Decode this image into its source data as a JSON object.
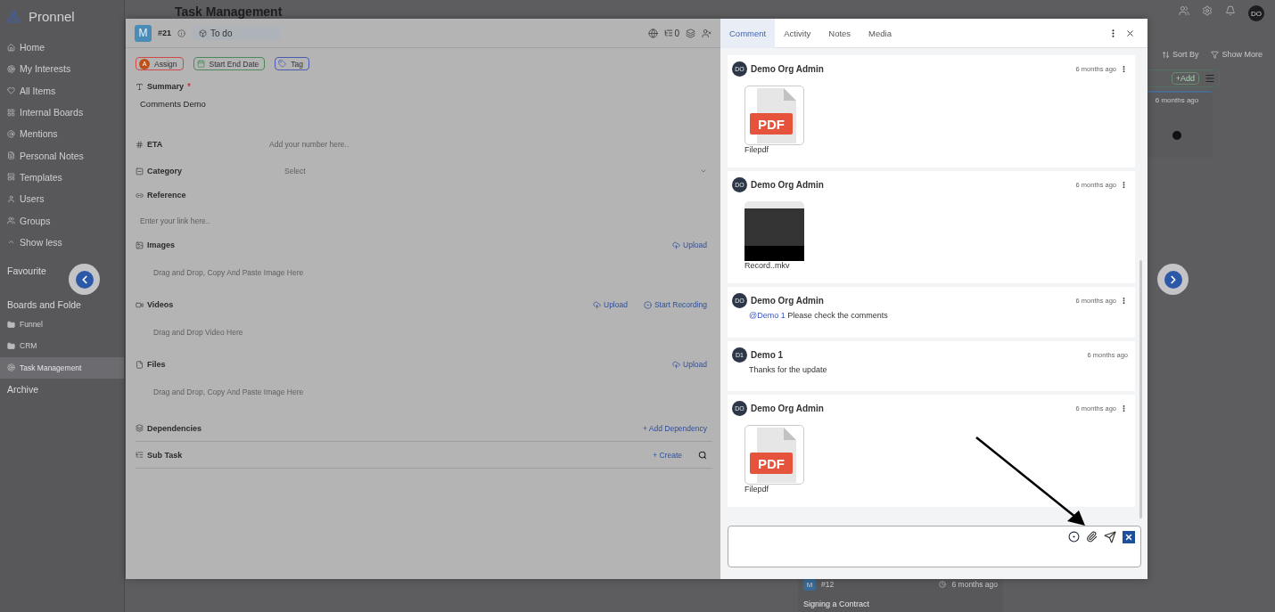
{
  "app": {
    "brand": "Pronnel",
    "page_title": "Task Management",
    "user_initials": "DO"
  },
  "sidebar": {
    "items": [
      {
        "label": "Home",
        "selected": false
      },
      {
        "label": "My Interests",
        "selected": false
      },
      {
        "label": "All Items",
        "selected": false
      },
      {
        "label": "Internal Boards",
        "selected": false
      },
      {
        "label": "Mentions",
        "selected": false
      },
      {
        "label": "Personal Notes",
        "selected": false
      },
      {
        "label": "Templates",
        "selected": false
      },
      {
        "label": "Users",
        "selected": false
      },
      {
        "label": "Groups",
        "selected": false
      }
    ],
    "toggle": "Show less",
    "sections": [
      "Favourite",
      "Boards and Folde"
    ],
    "folders": [
      {
        "label": "Funnel",
        "kind": "folder",
        "selected": false
      },
      {
        "label": "CRM",
        "kind": "folder",
        "selected": false
      },
      {
        "label": "Task Management",
        "kind": "board",
        "selected": true
      }
    ],
    "archive": "Archive"
  },
  "board": {
    "toolbar": [
      "Sort By",
      "Show More"
    ],
    "add_button": "+Add",
    "card_time": "6 months ago",
    "bottom_card": {
      "badge": "M",
      "number": "#12",
      "time": "6 months ago",
      "title": "Signing a Contract"
    }
  },
  "task": {
    "avatar": "M",
    "number": "#21",
    "status": "To do",
    "watchers": "0",
    "chips": [
      {
        "label": "Assign",
        "kind": "assign",
        "avatar": "A"
      },
      {
        "label": "Start End Date",
        "kind": "date"
      },
      {
        "label": "Tag",
        "kind": "tag"
      }
    ],
    "fields": [
      {
        "kind": "textarea",
        "label": "Summary",
        "required_mark": "*",
        "value": "Comments Demo"
      },
      {
        "kind": "inline",
        "label": "ETA",
        "placeholder": "Add your number here.."
      },
      {
        "kind": "select",
        "label": "Category",
        "placeholder": "Select"
      },
      {
        "kind": "link",
        "label": "Reference",
        "placeholder": "Enter your link here.."
      },
      {
        "kind": "drop",
        "label": "Images",
        "hint": "Drag and Drop, Copy And Paste Image Here",
        "actions": [
          {
            "label": "Upload",
            "kind": "upload"
          }
        ]
      },
      {
        "kind": "drop",
        "label": "Videos",
        "hint": "Drag and Drop Video Here",
        "actions": [
          {
            "label": "Upload",
            "kind": "upload"
          },
          {
            "label": "Start Recording",
            "kind": "record"
          }
        ]
      },
      {
        "kind": "drop",
        "label": "Files",
        "hint": "Drag and Drop, Copy And Paste Image Here",
        "actions": [
          {
            "label": "Upload",
            "kind": "upload"
          }
        ]
      },
      {
        "kind": "list",
        "label": "Dependencies",
        "actions": [
          {
            "label": "+ Add Dependency",
            "kind": "add"
          }
        ]
      },
      {
        "kind": "list",
        "label": "Sub Task",
        "actions": [
          {
            "label": "+ Create",
            "kind": "add"
          },
          {
            "kind": "search"
          }
        ]
      }
    ]
  },
  "panel": {
    "tabs": [
      {
        "label": "Comment",
        "selected": true
      },
      {
        "label": "Activity",
        "selected": false
      },
      {
        "label": "Notes",
        "selected": false
      },
      {
        "label": "Media",
        "selected": false
      }
    ],
    "comments": [
      {
        "author": "Demo Org Admin",
        "initials": "DO",
        "time": "6 months ago",
        "menu": true,
        "kind": "file",
        "file_type": "PDF",
        "file_name": "Filepdf"
      },
      {
        "author": "Demo Org Admin",
        "initials": "DO",
        "time": "6 months ago",
        "menu": true,
        "kind": "video",
        "file_name": "Record..mkv"
      },
      {
        "author": "Demo Org Admin",
        "initials": "DO",
        "time": "6 months ago",
        "menu": true,
        "kind": "text",
        "mention": "@Demo 1",
        "text": "Please check the comments"
      },
      {
        "author": "Demo 1",
        "initials": "D1",
        "time": "6 months ago",
        "menu": false,
        "kind": "text",
        "text": "Thanks for the update"
      },
      {
        "author": "Demo Org Admin",
        "initials": "DO",
        "time": "6 months ago",
        "menu": true,
        "kind": "file",
        "file_type": "PDF",
        "file_name": "Filepdf"
      }
    ]
  }
}
